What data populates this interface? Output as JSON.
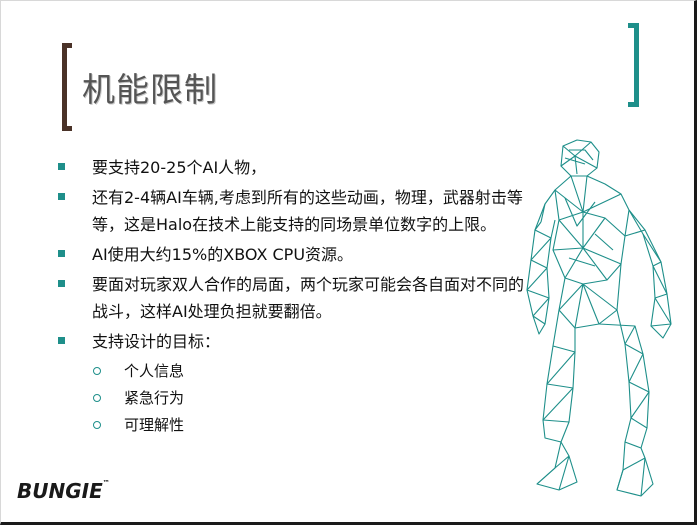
{
  "slide": {
    "title": "机能限制",
    "bullets": [
      {
        "text": "要支持20-25个AI人物，"
      },
      {
        "text": "还有2-4辆AI车辆,考虑到所有的这些动画，物理，武器射击等等，这是Halo在技术上能支持的同场景单位数字的上限。"
      },
      {
        "text": "AI使用大约15%的XBOX CPU资源。"
      },
      {
        "text": "要面对玩家双人合作的局面，两个玩家可能会各自面对不同的战斗，这样AI处理负担就要翻倍。"
      },
      {
        "text": "支持设计的目标："
      }
    ],
    "sub_bullets": [
      {
        "text": "个人信息"
      },
      {
        "text": "紧急行为"
      },
      {
        "text": "可理解性"
      }
    ],
    "logo": {
      "text": "BUNGIE",
      "tm": "™"
    },
    "colors": {
      "accent": "#1e8f8a",
      "bracket_left": "#4a3228",
      "title": "#555555",
      "wireframe": "#1e8f8a"
    }
  }
}
